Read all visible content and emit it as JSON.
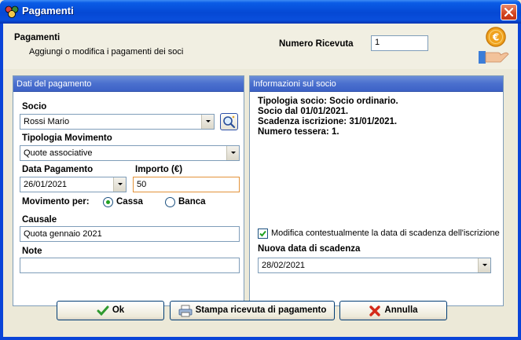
{
  "window": {
    "title": "Pagamenti"
  },
  "header": {
    "title": "Pagamenti",
    "subtitle": "Aggiungi o modifica i pagamenti dei soci",
    "numero_ricevuta_label": "Numero Ricevuta",
    "numero_ricevuta_value": "1",
    "icon": "coin-hand-icon"
  },
  "dati_pagamento": {
    "header": "Dati del pagamento",
    "socio_label": "Socio",
    "socio_value": "Rossi Mario",
    "tipologia_label": "Tipologia Movimento",
    "tipologia_value": "Quote associative",
    "data_label": "Data Pagamento",
    "data_value": "26/01/2021",
    "importo_label": "Importo (€)",
    "importo_value": "50",
    "movimento_label": "Movimento per:",
    "radio_cassa": "Cassa",
    "radio_banca": "Banca",
    "movimento_selected": "Cassa",
    "causale_label": "Causale",
    "causale_value": "Quota gennaio 2021",
    "note_label": "Note",
    "note_value": ""
  },
  "info_socio": {
    "header": "Informazioni sul socio",
    "lines": [
      "Tipologia socio: Socio ordinario.",
      "Socio dal 01/01/2021.",
      "Scadenza iscrizione: 31/01/2021.",
      "Numero tessera: 1."
    ],
    "checkbox_label": "Modifica contestualmente la data di scadenza dell'iscrizione",
    "checkbox_checked": true,
    "nuova_data_label": "Nuova data di scadenza",
    "nuova_data_value": "28/02/2021"
  },
  "buttons": {
    "ok": "Ok",
    "stampa": "Stampa ricevuta di pagamento",
    "annulla": "Annulla"
  },
  "colors": {
    "title_bar": "#0548d4",
    "group_header": "#4a6fce",
    "radio_dot": "#21a121",
    "focus_border": "#e3933a"
  }
}
